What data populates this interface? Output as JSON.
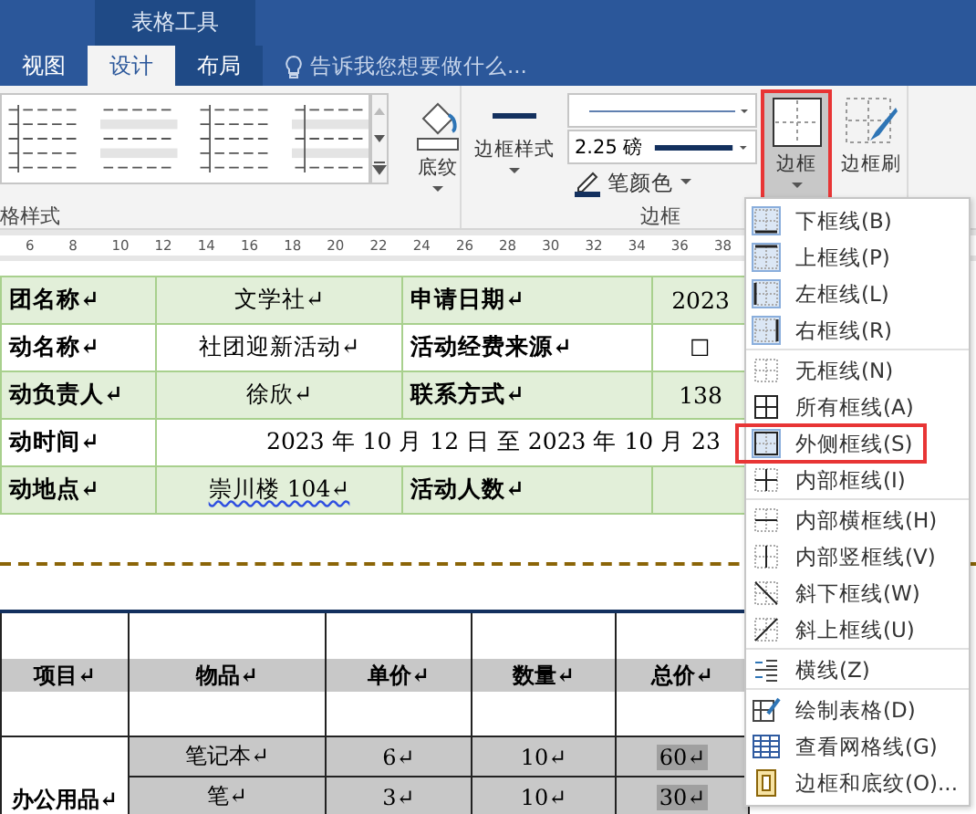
{
  "title_bar": {
    "context_tab": "表格工具"
  },
  "tabs": [
    {
      "label": "视图",
      "selected": false,
      "contextual": false
    },
    {
      "label": "设计",
      "selected": true,
      "contextual": true
    },
    {
      "label": "布局",
      "selected": false,
      "contextual": true
    }
  ],
  "tell_me": {
    "placeholder": "告诉我您想要做什么..."
  },
  "ribbon": {
    "table_styles": {
      "label": "格样式",
      "shading": "底纹"
    },
    "borders": {
      "label": "边框",
      "border_styles": "边框样式",
      "line_weight": "2.25 磅",
      "pen_color": "笔颜色",
      "borders_button": {
        "label": "边框",
        "annotated": true
      },
      "border_painter": "边框刷"
    }
  },
  "ruler": [
    "6",
    "8",
    "10",
    "12",
    "14",
    "16",
    "18",
    "20",
    "22",
    "24",
    "26",
    "28",
    "30",
    "32",
    "34",
    "36",
    "38"
  ],
  "form_table": {
    "rows": [
      {
        "shaded": true,
        "cells": [
          {
            "text": "团名称↵",
            "kind": "label"
          },
          {
            "text": "文学社↵",
            "kind": "value"
          },
          {
            "text": "申请日期↵",
            "kind": "label"
          },
          {
            "text": "2023",
            "kind": "value"
          }
        ]
      },
      {
        "shaded": false,
        "cells": [
          {
            "text": "动名称↵",
            "kind": "label"
          },
          {
            "text": "社团迎新活动↵",
            "kind": "value"
          },
          {
            "text": "活动经费来源↵",
            "kind": "label"
          },
          {
            "text": "☐",
            "kind": "value"
          }
        ]
      },
      {
        "shaded": true,
        "cells": [
          {
            "text": "动负责人↵",
            "kind": "label"
          },
          {
            "text": "徐欣↵",
            "kind": "value"
          },
          {
            "text": "联系方式↵",
            "kind": "label"
          },
          {
            "text": "138",
            "kind": "value"
          }
        ]
      },
      {
        "shaded": false,
        "cells": [
          {
            "text": "动时间↵",
            "kind": "label"
          },
          {
            "text": "2023 年 10 月 12 日 至 2023 年 10 月 23",
            "kind": "wide",
            "colspan": 3
          }
        ]
      },
      {
        "shaded": true,
        "cells": [
          {
            "text": "动地点↵",
            "kind": "label"
          },
          {
            "text": "崇川楼 104↵",
            "kind": "value",
            "flagged": true
          },
          {
            "text": "活动人数↵",
            "kind": "label"
          }
        ]
      }
    ]
  },
  "budget_table": {
    "columns": [
      "项目↵",
      "物品↵",
      "单价↵",
      "数量↵",
      "总价↵"
    ],
    "groups": [
      {
        "item": "办公用品↵",
        "lines": [
          [
            "笔记本↵",
            "6↵",
            "10↵",
            "60↵"
          ],
          [
            "笔↵",
            "3↵",
            "10↵",
            "30↵"
          ]
        ]
      }
    ]
  },
  "borders_menu": [
    {
      "label": "下框线(B)",
      "kind": "bottom",
      "on": true,
      "annotated": false
    },
    {
      "label": "上框线(P)",
      "kind": "top",
      "on": true,
      "annotated": false
    },
    {
      "label": "左框线(L)",
      "kind": "left",
      "on": true,
      "annotated": false
    },
    {
      "label": "右框线(R)",
      "kind": "right",
      "on": true,
      "annotated": false,
      "separator": true
    },
    {
      "label": "无框线(N)",
      "kind": "none",
      "on": false,
      "annotated": false
    },
    {
      "label": "所有框线(A)",
      "kind": "all",
      "on": false,
      "annotated": false
    },
    {
      "label": "外侧框线(S)",
      "kind": "outside",
      "on": true,
      "annotated": true
    },
    {
      "label": "内部框线(I)",
      "kind": "inside",
      "on": false,
      "annotated": false,
      "separator": true
    },
    {
      "label": "内部横框线(H)",
      "kind": "inside-h",
      "on": false,
      "annotated": false
    },
    {
      "label": "内部竖框线(V)",
      "kind": "inside-v",
      "on": false,
      "annotated": false
    },
    {
      "label": "斜下框线(W)",
      "kind": "diag-down",
      "on": false,
      "annotated": false
    },
    {
      "label": "斜上框线(U)",
      "kind": "diag-up",
      "on": false,
      "annotated": false,
      "separator": true
    },
    {
      "label": "横线(Z)",
      "kind": "hline",
      "on": false,
      "annotated": false,
      "separator": true
    },
    {
      "label": "绘制表格(D)",
      "kind": "draw",
      "on": false,
      "annotated": false
    },
    {
      "label": "查看网格线(G)",
      "kind": "grid",
      "on": false,
      "annotated": false
    },
    {
      "label": "边框和底纹(O)...",
      "kind": "dialog",
      "on": false,
      "annotated": false
    }
  ]
}
